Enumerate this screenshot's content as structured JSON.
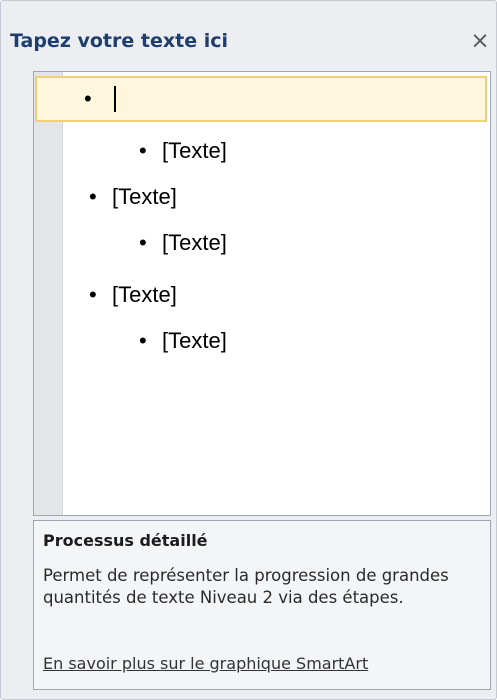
{
  "pane": {
    "title": "Tapez votre texte ici",
    "close_glyph": "×",
    "close_icon": "close-icon"
  },
  "editor": {
    "bullet_glyph": "•",
    "items": [
      {
        "level": 1,
        "text": "",
        "selected": true,
        "has_caret": true
      },
      {
        "level": 2,
        "text": "[Texte]",
        "selected": false
      },
      {
        "level": 1,
        "text": "[Texte]",
        "selected": false
      },
      {
        "level": 2,
        "text": "[Texte]",
        "selected": false
      },
      {
        "level": 1,
        "text": "[Texte]",
        "selected": false
      },
      {
        "level": 2,
        "text": "[Texte]",
        "selected": false
      }
    ]
  },
  "info": {
    "title": "Processus détaillé",
    "description": "Permet de représenter la progression de grandes quantités de texte Niveau 2 via des étapes.",
    "link": "En savoir plus sur le graphique SmartArt"
  },
  "colors": {
    "title": "#1e3e6e",
    "selection_fill": "#fff6de",
    "selection_border": "#f0cf78",
    "pane_background": "#eceef2"
  }
}
